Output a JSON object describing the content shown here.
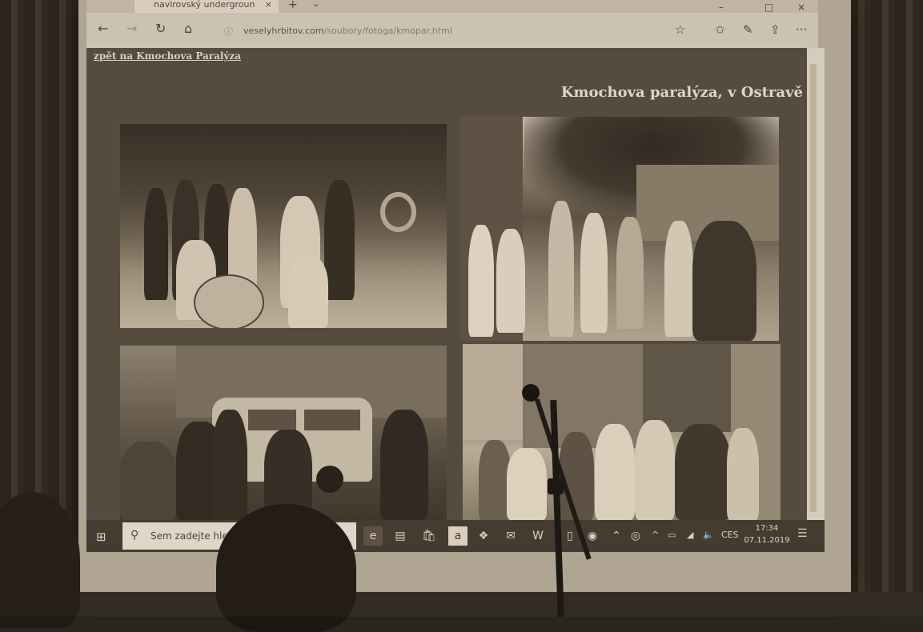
{
  "browser": {
    "tab_title": "navirovský undergroun",
    "tab_close": "×",
    "new_tab": "+",
    "tab_list": "⌄",
    "minimize": "–",
    "maximize": "□",
    "close": "×",
    "back": "←",
    "forward": "→",
    "refresh": "↻",
    "home": "⌂",
    "url_host": "veselyhrbitov.com",
    "url_path": "/soubory/fotoga/kmopar.html",
    "tools": [
      "☆",
      "✩",
      "✎",
      "⇪",
      "···"
    ]
  },
  "page": {
    "back_link": "zpět na Kmochova Paralýza",
    "heading": "Kmochova paralýza, v Ostravě"
  },
  "taskbar": {
    "start": "⊞",
    "search_icon": "⚲",
    "search_placeholder": "Sem zadejte hle",
    "apps": [
      "e",
      "▤",
      "🛍",
      "a",
      "❖",
      "✉",
      "W",
      "▯",
      "◉",
      "⌃",
      "◎"
    ],
    "tray_up": "^",
    "language": "CES",
    "time": "17:34",
    "date": "07.11.2019",
    "notifications": "☰"
  },
  "colors": {
    "page_bg": "#524b41",
    "heading": "#f1e9da",
    "taskbar": "#3f3932"
  }
}
